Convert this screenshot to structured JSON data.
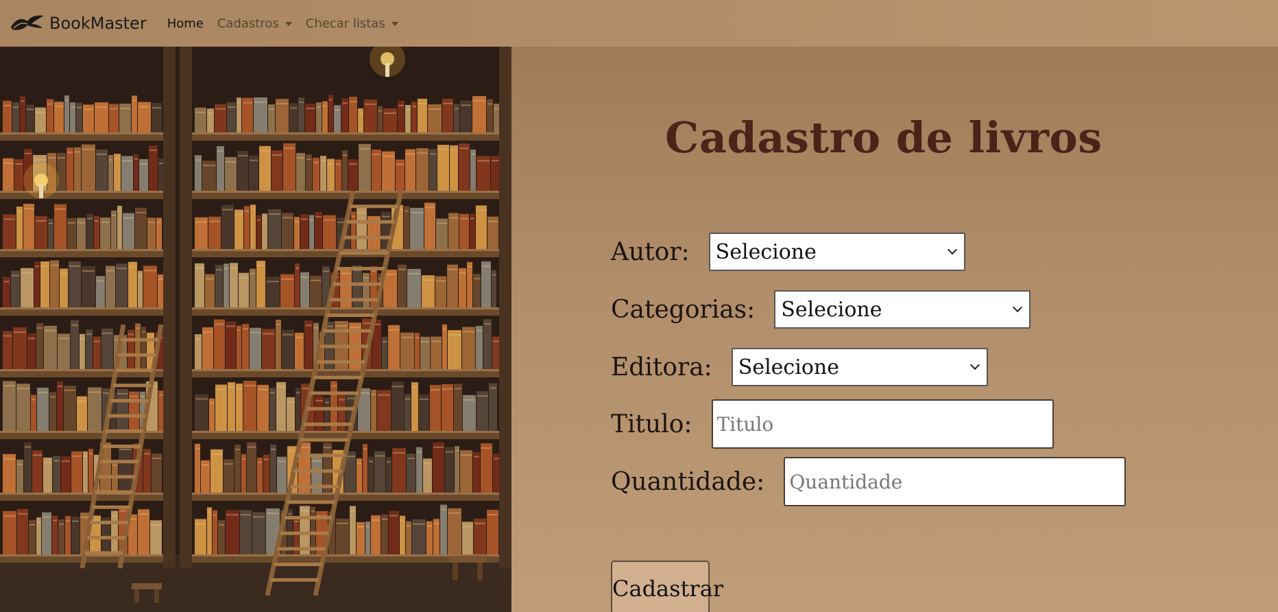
{
  "navbar": {
    "brand": "BookMaster",
    "links": [
      {
        "label": "Home",
        "active": true
      },
      {
        "label": "Cadastros",
        "dropdown": true
      },
      {
        "label": "Checar listas",
        "dropdown": true
      }
    ]
  },
  "form": {
    "title": "Cadastro de livros",
    "autor": {
      "label": "Autor:",
      "selected": "Selecione"
    },
    "categorias": {
      "label": "Categorias:",
      "selected": "Selecione"
    },
    "editora": {
      "label": "Editora:",
      "selected": "Selecione"
    },
    "titulo": {
      "label": "Titulo:",
      "placeholder": "Titulo",
      "value": ""
    },
    "quantidade": {
      "label": "Quantidade:",
      "placeholder": "Quantidade",
      "value": ""
    },
    "submit_label": "Cadastrar"
  },
  "colors": {
    "navbar_bg": "#b08c68",
    "panel_bg": "#b28e6b",
    "title": "#4a2419",
    "button_bg": "#d2b08f"
  },
  "icons": {
    "brand": "bird-logo-icon",
    "dropdown": "caret-down-icon",
    "select": "chevron-down-icon"
  }
}
